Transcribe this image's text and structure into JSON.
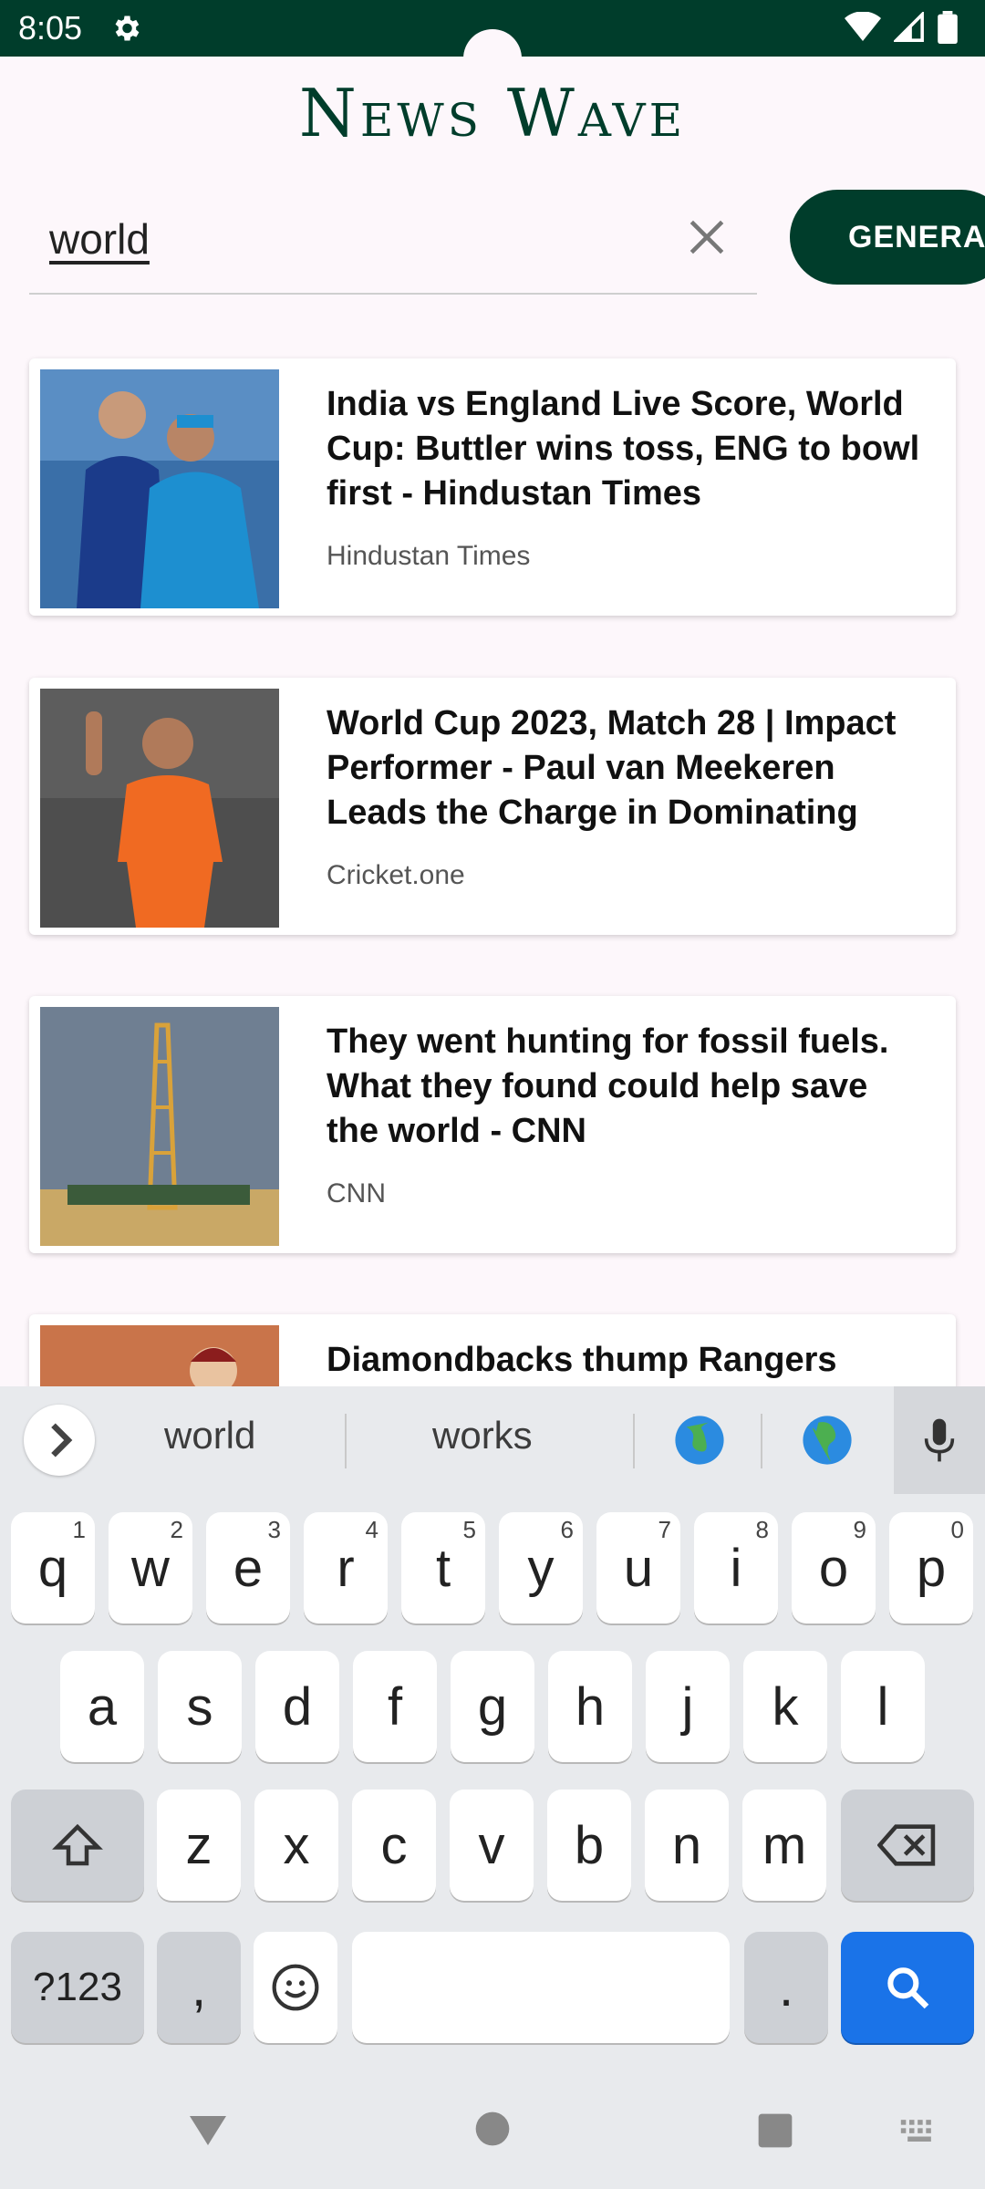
{
  "status": {
    "time": "8:05"
  },
  "app": {
    "title": "News Wave"
  },
  "search": {
    "query": "world",
    "button_label": "GENERAL"
  },
  "articles": [
    {
      "headline": "India vs England Live Score, World Cup: Buttler wins toss, ENG to bowl first - Hindustan Times",
      "source": "Hindustan Times"
    },
    {
      "headline": "World Cup 2023, Match 28 | Impact Performer - Paul van Meekeren Leads the Charge in Dominating",
      "source": "Cricket.one"
    },
    {
      "headline": "They went hunting for fossil fuels. What they found could help save the world - CNN",
      "source": "CNN"
    },
    {
      "headline": "Diamondbacks thump Rangers",
      "source": ""
    }
  ],
  "keyboard": {
    "suggestions": [
      "world",
      "works"
    ],
    "row1": [
      {
        "k": "q",
        "h": "1"
      },
      {
        "k": "w",
        "h": "2"
      },
      {
        "k": "e",
        "h": "3"
      },
      {
        "k": "r",
        "h": "4"
      },
      {
        "k": "t",
        "h": "5"
      },
      {
        "k": "y",
        "h": "6"
      },
      {
        "k": "u",
        "h": "7"
      },
      {
        "k": "i",
        "h": "8"
      },
      {
        "k": "o",
        "h": "9"
      },
      {
        "k": "p",
        "h": "0"
      }
    ],
    "row2": [
      "a",
      "s",
      "d",
      "f",
      "g",
      "h",
      "j",
      "k",
      "l"
    ],
    "row3": [
      "z",
      "x",
      "c",
      "v",
      "b",
      "n",
      "m"
    ],
    "symbols_label": "?123",
    "comma": ",",
    "period": "."
  }
}
